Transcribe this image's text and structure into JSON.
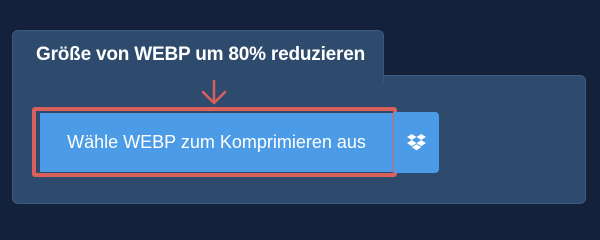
{
  "converter": {
    "title": "Größe von WEBP um 80% reduzieren",
    "select_button_label": "Wähle WEBP zum Komprimieren aus",
    "dropbox_icon": "dropbox-icon",
    "highlight_color": "#d9605c",
    "button_color": "#4c9be6"
  }
}
